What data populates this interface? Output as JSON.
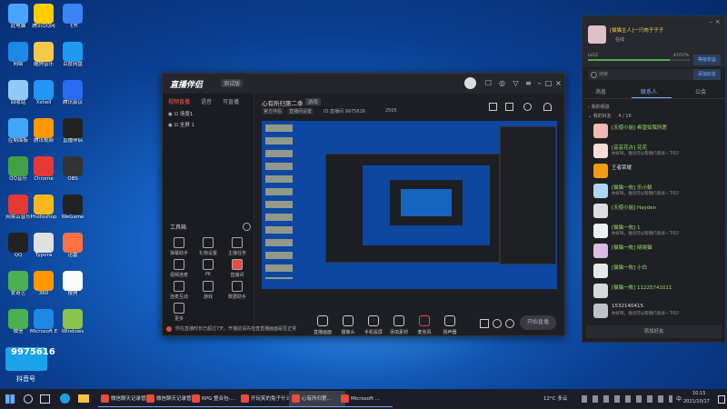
{
  "desktop": {
    "icons": [
      {
        "label": "此电脑",
        "color": "#4aa3ff"
      },
      {
        "label": "腾讯QQ网",
        "color": "#ffcc00"
      },
      {
        "label": "飞书",
        "color": "#3b82f6"
      },
      {
        "label": "网络",
        "color": "#1e88e5"
      },
      {
        "label": "酷狗音乐",
        "color": "#f5c84c"
      },
      {
        "label": "百度网盘",
        "color": "#1e9bf0"
      },
      {
        "label": "回收站",
        "color": "#90caf9"
      },
      {
        "label": "Xshell",
        "color": "#2196f3"
      },
      {
        "label": "腾讯会议",
        "color": "#2a6bf2"
      },
      {
        "label": "控制面板",
        "color": "#42a5f5"
      },
      {
        "label": "腾讯视频",
        "color": "#ff9800"
      },
      {
        "label": "直播伴侣",
        "color": "#222222"
      },
      {
        "label": "QQ音乐",
        "color": "#43a047"
      },
      {
        "label": "Chrome",
        "color": "#e53935"
      },
      {
        "label": "OBS",
        "color": "#333333"
      },
      {
        "label": "网易云音乐",
        "color": "#e53935"
      },
      {
        "label": "Photoshop",
        "color": "#f6b81e"
      },
      {
        "label": "WeGame",
        "color": "#222222"
      },
      {
        "label": "QQ",
        "color": "#222222"
      },
      {
        "label": "Typora",
        "color": "#e0e0e0"
      },
      {
        "label": "迅雷",
        "color": "#ff7043"
      },
      {
        "label": "爱奇艺",
        "color": "#4caf50"
      },
      {
        "label": "360",
        "color": "#ff9800"
      },
      {
        "label": "搜狗",
        "color": "#fafafa"
      },
      {
        "label": "微信",
        "color": "#4caf50"
      },
      {
        "label": "Microsoft Edge",
        "color": "#1e88e5"
      },
      {
        "label": "Windows",
        "color": "#8bc34a"
      }
    ],
    "overlay_badge": "9975616",
    "overlay_text": "抖音号"
  },
  "main_window": {
    "logo": "直播伴侣",
    "logo_badge": "测试版",
    "left_tabs": [
      "视频直播",
      "语音",
      "可直播"
    ],
    "scene_rows": [
      "场景1",
      "全屏 1"
    ],
    "tools_title": "工具箱",
    "tools": [
      "弹幕助手",
      "礼物设置",
      "主播任务",
      "视频连麦",
      "PK",
      "直播间",
      "连麦互动",
      "游戏",
      "数据助手",
      "更多"
    ],
    "status": "你在直播时长已超过7天，开播前请先检查直播画面是否正常",
    "room_title": "心有所归第二季",
    "room_tag": "游戏",
    "room_meta": [
      "官方伴侣",
      "直播间设置"
    ],
    "room_id": "ID:直播间 9975616",
    "hot": "2505",
    "bottom_buttons": [
      "直播画面",
      "摄像头",
      "手机投屏",
      "添加素材",
      "麦克风",
      "扬声器"
    ],
    "start_button": "开始直播"
  },
  "panel": {
    "user_name": "[猫猫主人]一只肉子子子",
    "user_status": "在线",
    "level_left": "LV22",
    "level_right": "47/57%",
    "level_pct": 80,
    "btn1": "等级权益",
    "btn2": "添加好友",
    "search_placeholder": "搜索",
    "tabs": [
      "消息",
      "联系人",
      "公会"
    ],
    "section1": "我的频道",
    "section2": "我的好友",
    "section2_count": "4 / 16",
    "contacts": [
      {
        "name": "[天使小姐]  希望如我所愿",
        "status": "",
        "color": "#f5b7b1"
      },
      {
        "name": "[芸芸花卉] 花花",
        "status": "你好呀，请问可以帮我们测试一下吗？",
        "color": "#fadbd8"
      },
      {
        "name": "王者荣耀",
        "status": "",
        "color": "#f39c12"
      },
      {
        "name": "[猫猫一枚] 乐小梨",
        "status": "你好呀，请问可以帮我们测试一下吗？",
        "color": "#aed6f1"
      },
      {
        "name": "[天使小姐]  Hayden",
        "status": "",
        "color": "#ddd"
      },
      {
        "name": "[猫猫一枚] 1",
        "status": "你好呀，请问可以帮我们测试一下吗？",
        "color": "#ecf0f1"
      },
      {
        "name": "[猫猫一枚]  晓晓猫",
        "status": "",
        "color": "#d7bde2"
      },
      {
        "name": "[猫猫一枚] 小白",
        "status": "",
        "color": "#e5e8e8"
      },
      {
        "name": "[猫猫一枚] 11225741011",
        "status": "",
        "color": "#d5dbdb"
      },
      {
        "name": "1532140415",
        "status": "你好呀，请问可以帮我们测试一下吗？",
        "color": "#bdc3c7"
      }
    ],
    "footer": "添加好友"
  },
  "taskbar": {
    "items": [
      "微信聊天记录管理...",
      "微信聊天记录管理...",
      "RPG 整合包-...",
      "开玩笑的兔子什么...",
      "心有所归第...",
      "Microsoft ..."
    ],
    "weather": "12°C 多云",
    "time": "10:15",
    "date": "2021/10/17",
    "lang": "中"
  }
}
